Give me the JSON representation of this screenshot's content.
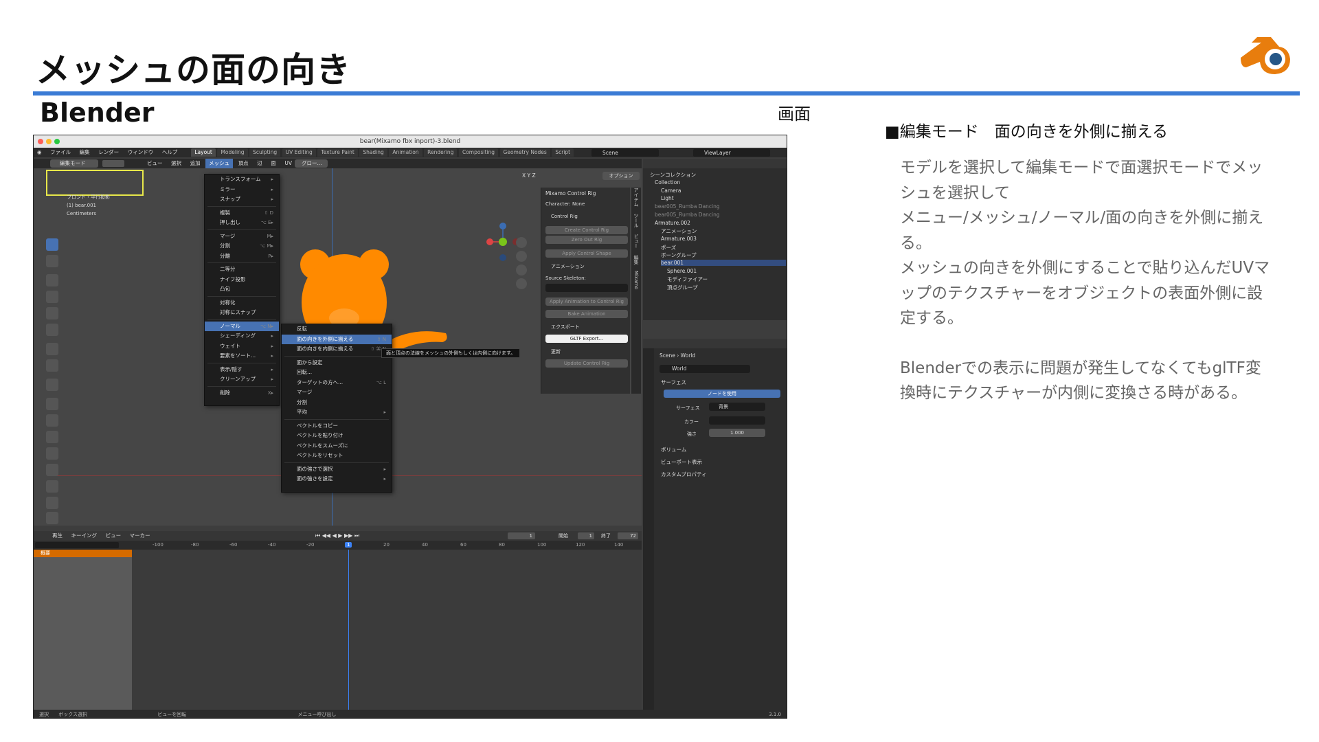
{
  "slide": {
    "title": "メッシュの面の向き",
    "section_title": "Blender",
    "screen_label": "画面",
    "description_heading": "■編集モード　面の向きを外側に揃える",
    "description_lines": [
      "モデルを選択して編集モードで面選択モードでメッ",
      "シュを選択して",
      "メニュー/メッシュ/ノーマル/面の向きを外側に揃え",
      "る。",
      "メッシュの向きを外側にすることで貼り込んだUVマ",
      "ップのテクスチャーをオブジェクトの表面外側に設",
      "定する。"
    ],
    "description_note": [
      "Blenderでの表示に問題が発生してなくてもglTF変",
      "換時にテクスチャーが内側に変換さる時がある。"
    ],
    "accent_color": "#3a7bd5",
    "logo_icon": "blender-logo-icon"
  },
  "blender": {
    "window_title": "bear(Mixamo fbx inport)-3.blend",
    "top_menu": [
      "ファイル",
      "編集",
      "レンダー",
      "ウィンドウ",
      "ヘルプ"
    ],
    "workspaces": [
      "Layout",
      "Modeling",
      "Sculpting",
      "UV Editing",
      "Texture Paint",
      "Shading",
      "Animation",
      "Rendering",
      "Compositing",
      "Geometry Nodes",
      "Script"
    ],
    "scene": "Scene",
    "view_layer": "ViewLayer",
    "header_mode": "編集モード",
    "header_menus": [
      "ビュー",
      "選択",
      "追加",
      "メッシュ",
      "頂点",
      "辺",
      "面",
      "UV"
    ],
    "transform_orientation": "グロー...",
    "options_label": "オプション",
    "axis_buttons": [
      "X",
      "Y",
      "Z"
    ],
    "view_info": [
      "フロント・平行投影",
      "(1) bear.001",
      "Centimeters"
    ],
    "mesh_menu": {
      "items": [
        {
          "label": "トランスフォーム",
          "shortcut": "▸"
        },
        {
          "label": "ミラー",
          "shortcut": "▸"
        },
        {
          "label": "スナップ",
          "shortcut": "▸"
        },
        {
          "label": "複製",
          "shortcut": "⇧ D"
        },
        {
          "label": "押し出し",
          "shortcut": "⌥ E▸"
        },
        {
          "label": "マージ",
          "shortcut": "M▸"
        },
        {
          "label": "分割",
          "shortcut": "⌥ M▸"
        },
        {
          "label": "分離",
          "shortcut": "P▸"
        },
        {
          "label": "二等分",
          "shortcut": ""
        },
        {
          "label": "ナイフ投影",
          "shortcut": ""
        },
        {
          "label": "凸包",
          "shortcut": ""
        },
        {
          "label": "対称化",
          "shortcut": ""
        },
        {
          "label": "対称にスナップ",
          "shortcut": ""
        },
        {
          "label": "ノーマル",
          "shortcut": "⌥ N▸"
        },
        {
          "label": "シェーディング",
          "shortcut": "▸"
        },
        {
          "label": "ウェイト",
          "shortcut": "▸"
        },
        {
          "label": "要素をソート...",
          "shortcut": "▸"
        },
        {
          "label": "表示/隠す",
          "shortcut": "▸"
        },
        {
          "label": "クリーンアップ",
          "shortcut": "▸"
        },
        {
          "label": "削除",
          "shortcut": "X▸"
        }
      ]
    },
    "normal_menu": {
      "items": [
        {
          "label": "反転",
          "shortcut": ""
        },
        {
          "label": "面の向きを外側に揃える",
          "shortcut": "⇧ N"
        },
        {
          "label": "面の向きを内側に揃える",
          "shortcut": "⇧ ⌘ N"
        },
        {
          "label": "面から設定",
          "shortcut": ""
        },
        {
          "label": "回転...",
          "shortcut": ""
        },
        {
          "label": "ターゲットの方へ...",
          "shortcut": "⌥ L"
        },
        {
          "label": "マージ",
          "shortcut": ""
        },
        {
          "label": "分割",
          "shortcut": ""
        },
        {
          "label": "平均",
          "shortcut": "▸"
        },
        {
          "label": "ベクトルをコピー",
          "shortcut": ""
        },
        {
          "label": "ベクトルを貼り付け",
          "shortcut": ""
        },
        {
          "label": "ベクトルをスムーズに",
          "shortcut": ""
        },
        {
          "label": "ベクトルをリセット",
          "shortcut": ""
        },
        {
          "label": "面の強さで選択",
          "shortcut": "▸"
        },
        {
          "label": "面の強さを設定",
          "shortcut": "▸"
        }
      ]
    },
    "tooltip": "面と頂点の法線をメッシュの外側もしくは内側に向けます。",
    "npanel": {
      "title": "Mixamo Control Rig",
      "character": "Character: None",
      "control_rig": "Control Rig",
      "create_btn": "Create Control Rig",
      "zero_btn": "Zero Out Rig",
      "apply_shape_btn": "Apply Control Shape",
      "animation": "アニメーション",
      "source_skeleton": "Source Skeleton:",
      "apply_anim_btn": "Apply Animation to Control Rig",
      "bake_btn": "Bake Animation",
      "export": "エクスポート",
      "gltf_btn": "GLTF Export...",
      "update": "更新",
      "update_btn": "Update Control Rig",
      "side_tabs": [
        "アイテム",
        "ツール",
        "ビュー",
        "編集",
        "Mixamo"
      ]
    },
    "outliner": {
      "header": "シーンコレクション",
      "items": [
        {
          "label": "Collection",
          "indent": 1
        },
        {
          "label": "Camera",
          "indent": 2
        },
        {
          "label": "Light",
          "indent": 2
        },
        {
          "label": "bear005_Rumba Dancing",
          "indent": 1
        },
        {
          "label": "bear005_Rumba Dancing",
          "indent": 1
        },
        {
          "label": "Armature.002",
          "indent": 1
        },
        {
          "label": "アニメーション",
          "indent": 2
        },
        {
          "label": "Armature.003",
          "indent": 2
        },
        {
          "label": "ポーズ",
          "indent": 2
        },
        {
          "label": "ボーングループ",
          "indent": 2
        },
        {
          "label": "bear.001",
          "indent": 2
        },
        {
          "label": "Sphere.001",
          "indent": 3
        },
        {
          "label": "モディファイアー",
          "indent": 3
        },
        {
          "label": "頂点グループ",
          "indent": 3
        }
      ]
    },
    "properties": {
      "breadcrumb_scene": "Scene",
      "breadcrumb_world": "World",
      "world_name": "World",
      "surface_section": "サーフェス",
      "use_nodes_btn": "ノードを使用",
      "surface_label": "サーフェス",
      "surface_value": "背景",
      "color_label": "カラー",
      "strength_label": "強さ",
      "strength_value": "1.000",
      "collapsed": [
        "ボリューム",
        "ビューポート表示",
        "カスタムプロパティ"
      ]
    },
    "timeline": {
      "menus": [
        "再生",
        "キーイング",
        "ビュー",
        "マーカー"
      ],
      "current_frame": "1",
      "start_label": "開始",
      "start": "1",
      "end_label": "終了",
      "end": "72",
      "ruler": [
        "-100",
        "-80",
        "-60",
        "-40",
        "-20",
        "1",
        "20",
        "40",
        "60",
        "80",
        "100",
        "120",
        "140"
      ],
      "summary": "概要"
    },
    "status": [
      "選択",
      "ボックス選択",
      "ビューを回転",
      "メニュー呼び出し"
    ],
    "version": "3.1.0"
  }
}
